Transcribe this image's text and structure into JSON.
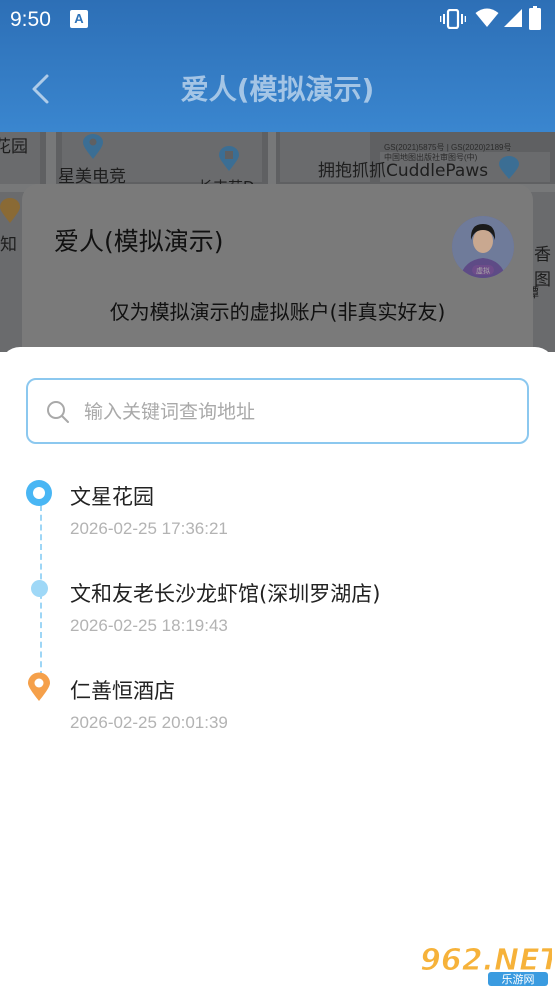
{
  "status_bar": {
    "time": "9:50",
    "app_icon_letter": "A"
  },
  "header": {
    "title": "爱人(模拟演示)"
  },
  "map": {
    "labels": [
      "花园",
      "星美电竞",
      "拥抱抓抓CuddlePaws",
      "长丰苑D",
      "知",
      "香图",
      "谭"
    ],
    "copyright": "GS(2021)5875号 | GS(2020)2189号",
    "copyright2": "中国地图出版社审图号(中)"
  },
  "profile_card": {
    "name": "爱人(模拟演示)",
    "description": "仅为模拟演示的虚拟账户(非真实好友)",
    "avatar_tag": "虚拟"
  },
  "search": {
    "placeholder": "输入关键词查询地址",
    "value": ""
  },
  "timeline": [
    {
      "title": "文星花园",
      "time": "2026-02-25 17:36:21",
      "marker": "start"
    },
    {
      "title": "文和友老长沙龙虾馆(深圳罗湖店)",
      "time": "2026-02-25 18:19:43",
      "marker": "mid"
    },
    {
      "title": "仁善恒酒店",
      "time": "2026-02-25 20:01:39",
      "marker": "end"
    }
  ],
  "watermark": {
    "text": "962.NET",
    "sub": "乐游网"
  },
  "colors": {
    "header": "#2d6fb6",
    "accent_blue": "#49b6f4",
    "end_pin": "#f5a04a",
    "search_border": "#8cc8ef"
  }
}
